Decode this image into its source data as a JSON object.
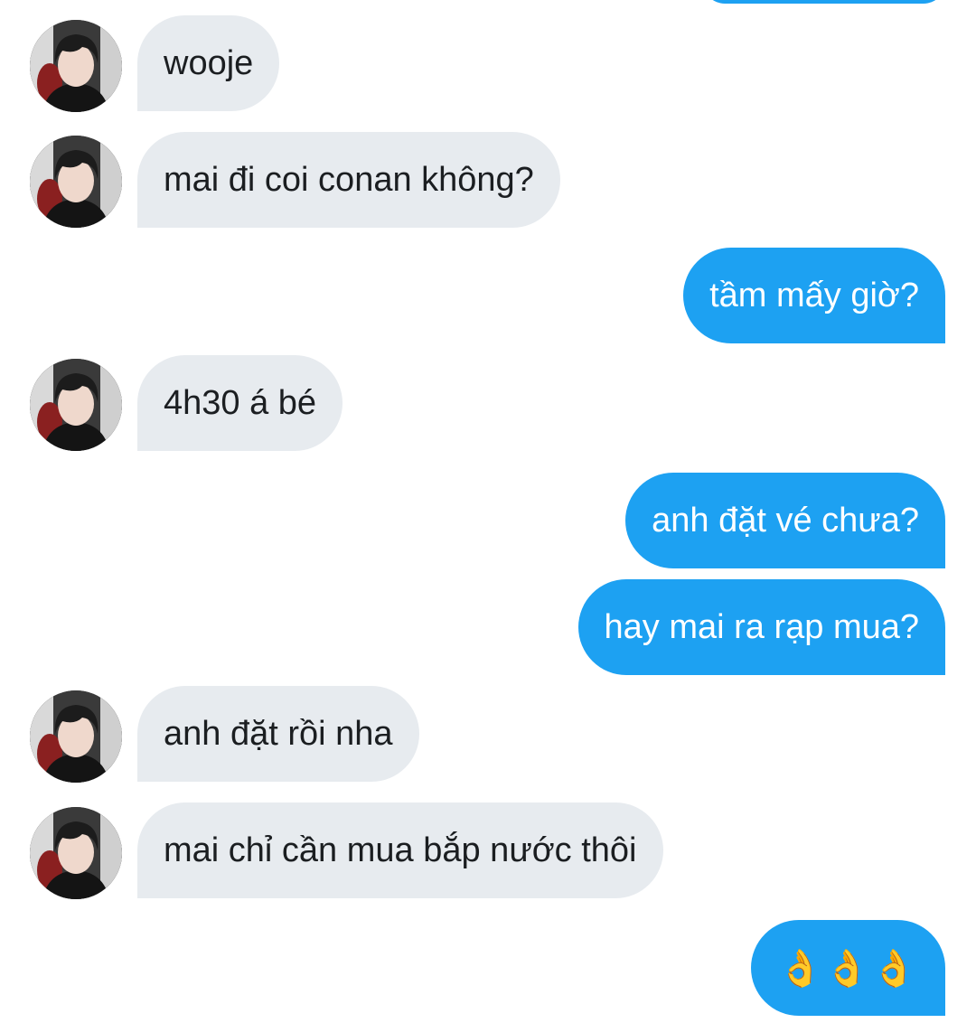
{
  "chat": {
    "incoming_bubble_color": "#e7ebef",
    "outgoing_bubble_color": "#1da1f2",
    "messages": [
      {
        "side": "in",
        "text": "wooje"
      },
      {
        "side": "in",
        "text": "mai đi coi conan không?"
      },
      {
        "side": "out",
        "text": "tầm mấy giờ?"
      },
      {
        "side": "in",
        "text": "4h30 á bé"
      },
      {
        "side": "out",
        "text": "anh đặt vé chưa?"
      },
      {
        "side": "out",
        "text": "hay mai ra rạp mua?"
      },
      {
        "side": "in",
        "text": "anh đặt rồi nha"
      },
      {
        "side": "in",
        "text": "mai chỉ cần mua bắp nước thôi"
      },
      {
        "side": "out",
        "text": "👌👌👌"
      }
    ]
  }
}
